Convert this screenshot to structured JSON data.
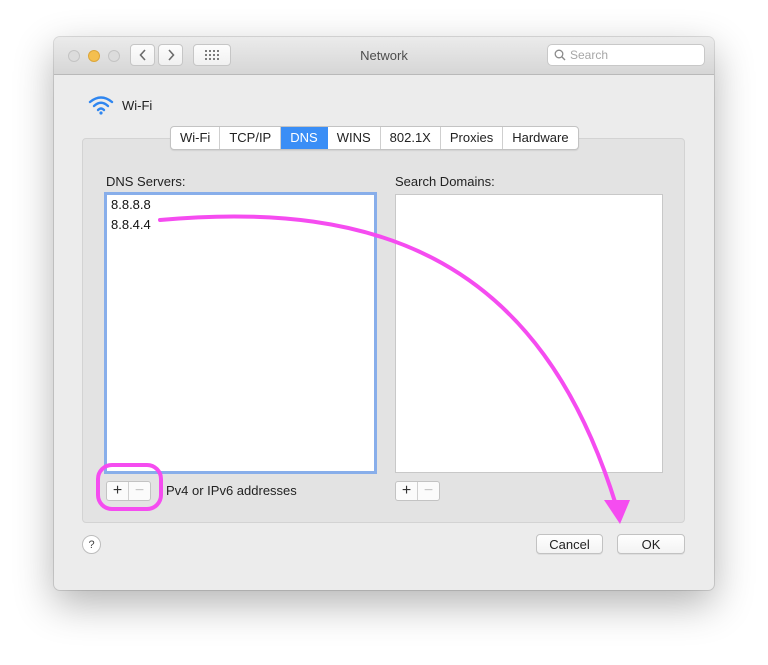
{
  "window": {
    "title": "Network"
  },
  "search": {
    "placeholder": "Search"
  },
  "interface": {
    "label": "Wi-Fi"
  },
  "tabs": [
    {
      "label": "Wi-Fi",
      "active": false
    },
    {
      "label": "TCP/IP",
      "active": false
    },
    {
      "label": "DNS",
      "active": true
    },
    {
      "label": "WINS",
      "active": false
    },
    {
      "label": "802.1X",
      "active": false
    },
    {
      "label": "Proxies",
      "active": false
    },
    {
      "label": "Hardware",
      "active": false
    }
  ],
  "dns": {
    "label": "DNS Servers:",
    "servers": [
      "8.8.8.8",
      "8.8.4.4"
    ],
    "hint": "Pv4 or IPv6 addresses"
  },
  "domains": {
    "label": "Search Domains:",
    "items": []
  },
  "controls": {
    "add": "+",
    "remove": "−"
  },
  "help": {
    "label": "?"
  },
  "buttons": {
    "cancel": "Cancel",
    "ok": "OK"
  },
  "colors": {
    "accent": "#3a8ef6",
    "annotation": "#f54cf0"
  }
}
